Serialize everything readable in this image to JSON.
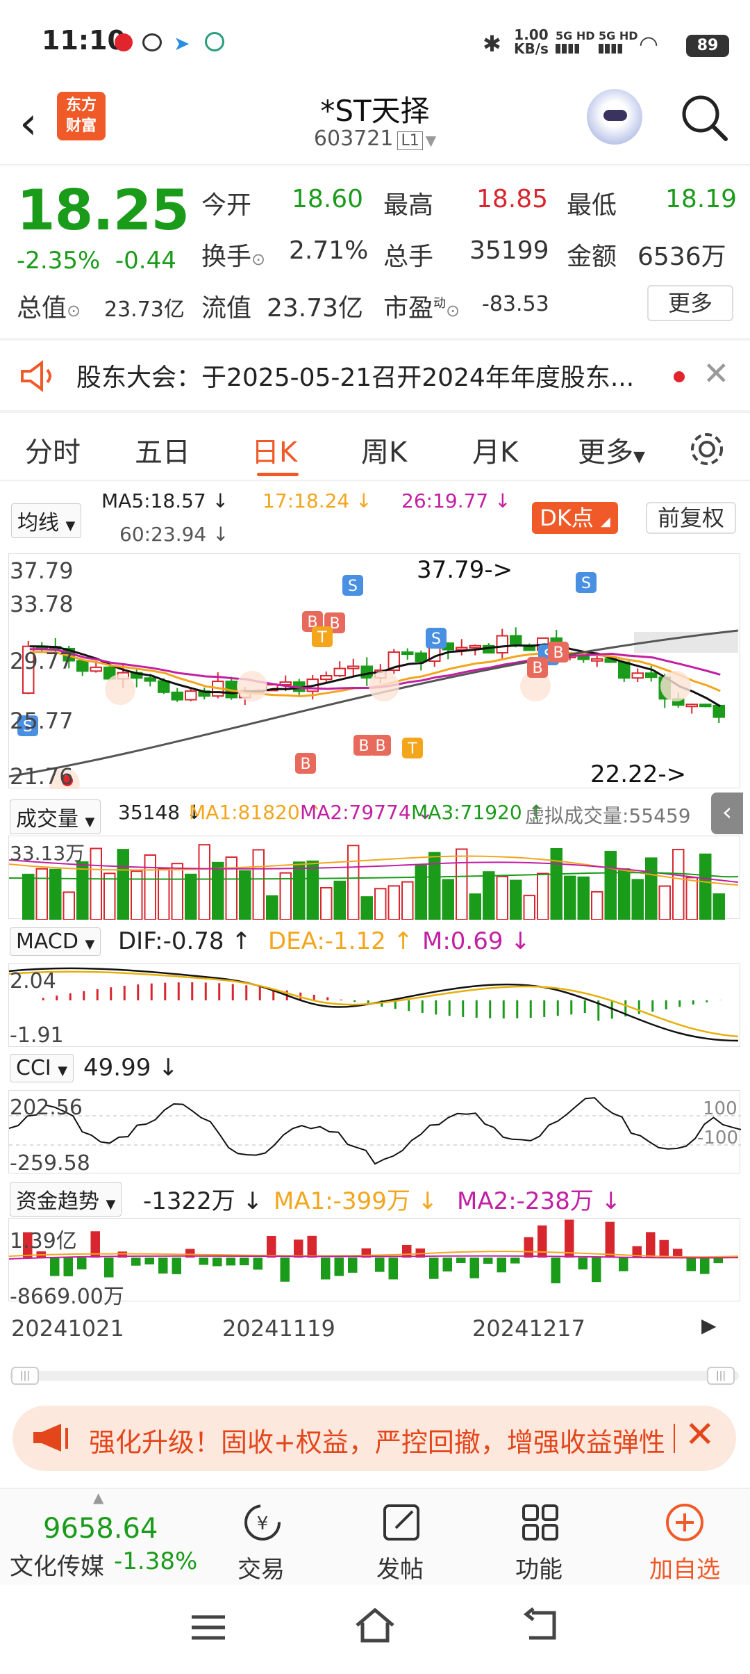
{
  "status": {
    "time": "11:10",
    "net_speed": "1.00",
    "net_unit": "KB/s",
    "signal1": "5G HD",
    "signal2": "5G HD",
    "battery": "89"
  },
  "header": {
    "logo_line1": "东方",
    "logo_line2": "财富",
    "title": "*ST天择",
    "code": "603721",
    "level": "L1"
  },
  "quote": {
    "price": "18.25",
    "change_pct": "-2.35%",
    "change_abs": "-0.44",
    "open_label": "今开",
    "open": "18.60",
    "high_label": "最高",
    "high": "18.85",
    "low_label": "最低",
    "low": "18.19",
    "turnover_label": "换手",
    "turnover": "2.71%",
    "volume_label": "总手",
    "volume": "35199",
    "amount_label": "金额",
    "amount": "6536万",
    "mktcap_label": "总值",
    "mktcap": "23.73亿",
    "float_label": "流值",
    "float": "23.73亿",
    "pe_label": "市盈",
    "pe_sup": "动",
    "pe": "-83.53",
    "more": "更多"
  },
  "notice": {
    "text": "股东大会：于2025-05-21召开2024年年度股东..."
  },
  "tabs": [
    "分时",
    "五日",
    "日K",
    "周K",
    "月K",
    "更多"
  ],
  "ma_bar": {
    "selector": "均线",
    "ma5": "MA5:18.57 ↓",
    "ma17": "17:18.24 ↓",
    "ma26": "26:19.77 ↓",
    "ma60": "60:23.94 ↓",
    "dk": "DK点",
    "fq": "前复权"
  },
  "kline": {
    "y_labels": [
      "37.79",
      "33.78",
      "29.77",
      "25.77",
      "21.76"
    ],
    "high_mark": "37.79->",
    "low_mark": "22.22->"
  },
  "volume_bar": {
    "selector": "成交量",
    "vol": "35148 ↓",
    "ma1": "MA1:81820 ↑",
    "ma2": "MA2:79774 ↓",
    "ma3": "MA3:71920 ↑",
    "virtual": "虚拟成交量:55459",
    "y_max": "33.13万"
  },
  "macd_bar": {
    "selector": "MACD",
    "dif": "DIF:-0.78 ↑",
    "dea": "DEA:-1.12 ↑",
    "m": "M:0.69 ↓",
    "y_max": "2.04",
    "y_min": "-1.91"
  },
  "cci_bar": {
    "selector": "CCI",
    "value": "49.99 ↓",
    "y_max": "202.56",
    "y_min": "-259.58",
    "ref_hi": "100",
    "ref_lo": "-100"
  },
  "fund_bar": {
    "selector": "资金趋势",
    "value": "-1322万 ↓",
    "ma1": "MA1:-399万 ↓",
    "ma2": "MA2:-238万 ↓",
    "y_max": "1.39亿",
    "y_min": "-8669.00万"
  },
  "dates": [
    "20241021",
    "20241119",
    "20241217"
  ],
  "promo": {
    "text": "强化升级！固收+权益，严控回撤，增强收益弹性"
  },
  "bottom_nav": {
    "index_value": "9658.64",
    "index_name": "文化传媒",
    "index_change": "-1.38%",
    "trade": "交易",
    "post": "发帖",
    "function": "功能",
    "add": "加自选"
  },
  "colors": {
    "up": "#d8262f",
    "down": "#1a9b1a",
    "accent": "#f05a28",
    "ma17": "#f3a51c",
    "ma26": "#c21fa3"
  }
}
